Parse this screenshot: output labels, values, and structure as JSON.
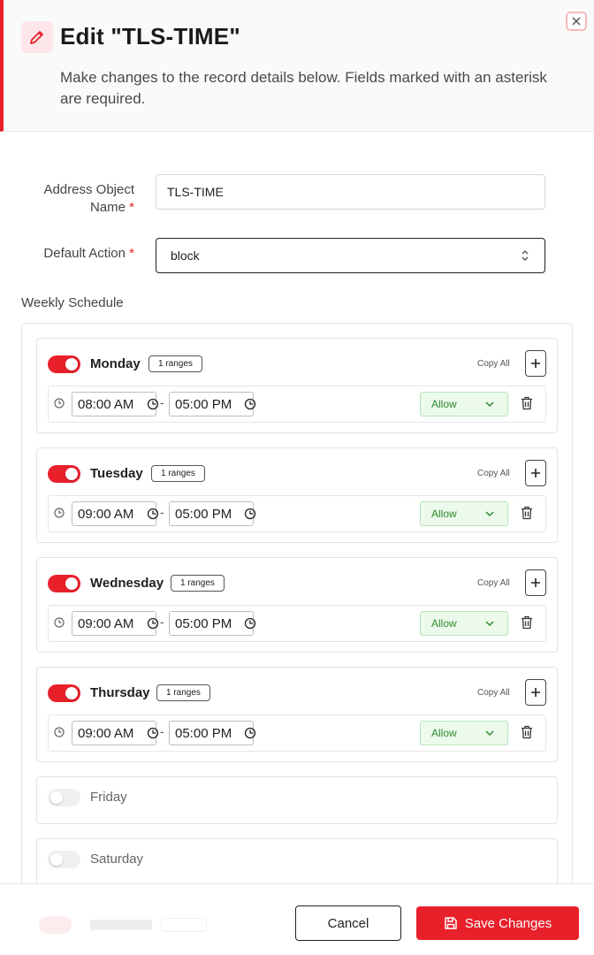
{
  "header": {
    "title": "Edit \"TLS-TIME\"",
    "subtitle": "Make changes to the record details below. Fields marked with an asterisk are required.",
    "icon": "pencil-icon",
    "close_icon": "close-icon"
  },
  "form": {
    "name_label_line1": "Address Object",
    "name_label_line2": "Name",
    "name_value": "TLS-TIME",
    "action_label": "Default Action",
    "action_value": "block",
    "required_mark": "*"
  },
  "schedule": {
    "title": "Weekly Schedule",
    "copy_all_label": "Copy All",
    "days": [
      {
        "name": "Monday",
        "enabled": true,
        "ranges_label": "1 ranges",
        "start": "08:00 AM",
        "end": "05:00 PM",
        "action": "Allow"
      },
      {
        "name": "Tuesday",
        "enabled": true,
        "ranges_label": "1 ranges",
        "start": "09:00 AM",
        "end": "05:00 PM",
        "action": "Allow"
      },
      {
        "name": "Wednesday",
        "enabled": true,
        "ranges_label": "1 ranges",
        "start": "09:00 AM",
        "end": "05:00 PM",
        "action": "Allow"
      },
      {
        "name": "Thursday",
        "enabled": true,
        "ranges_label": "1 ranges",
        "start": "09:00 AM",
        "end": "05:00 PM",
        "action": "Allow"
      },
      {
        "name": "Friday",
        "enabled": false
      },
      {
        "name": "Saturday",
        "enabled": false
      }
    ],
    "range_separator": "-"
  },
  "footer": {
    "cancel_label": "Cancel",
    "save_label": "Save Changes"
  },
  "colors": {
    "accent": "#e8202a",
    "allow_bg": "#ecfaec",
    "allow_text": "#2e8a2e"
  }
}
